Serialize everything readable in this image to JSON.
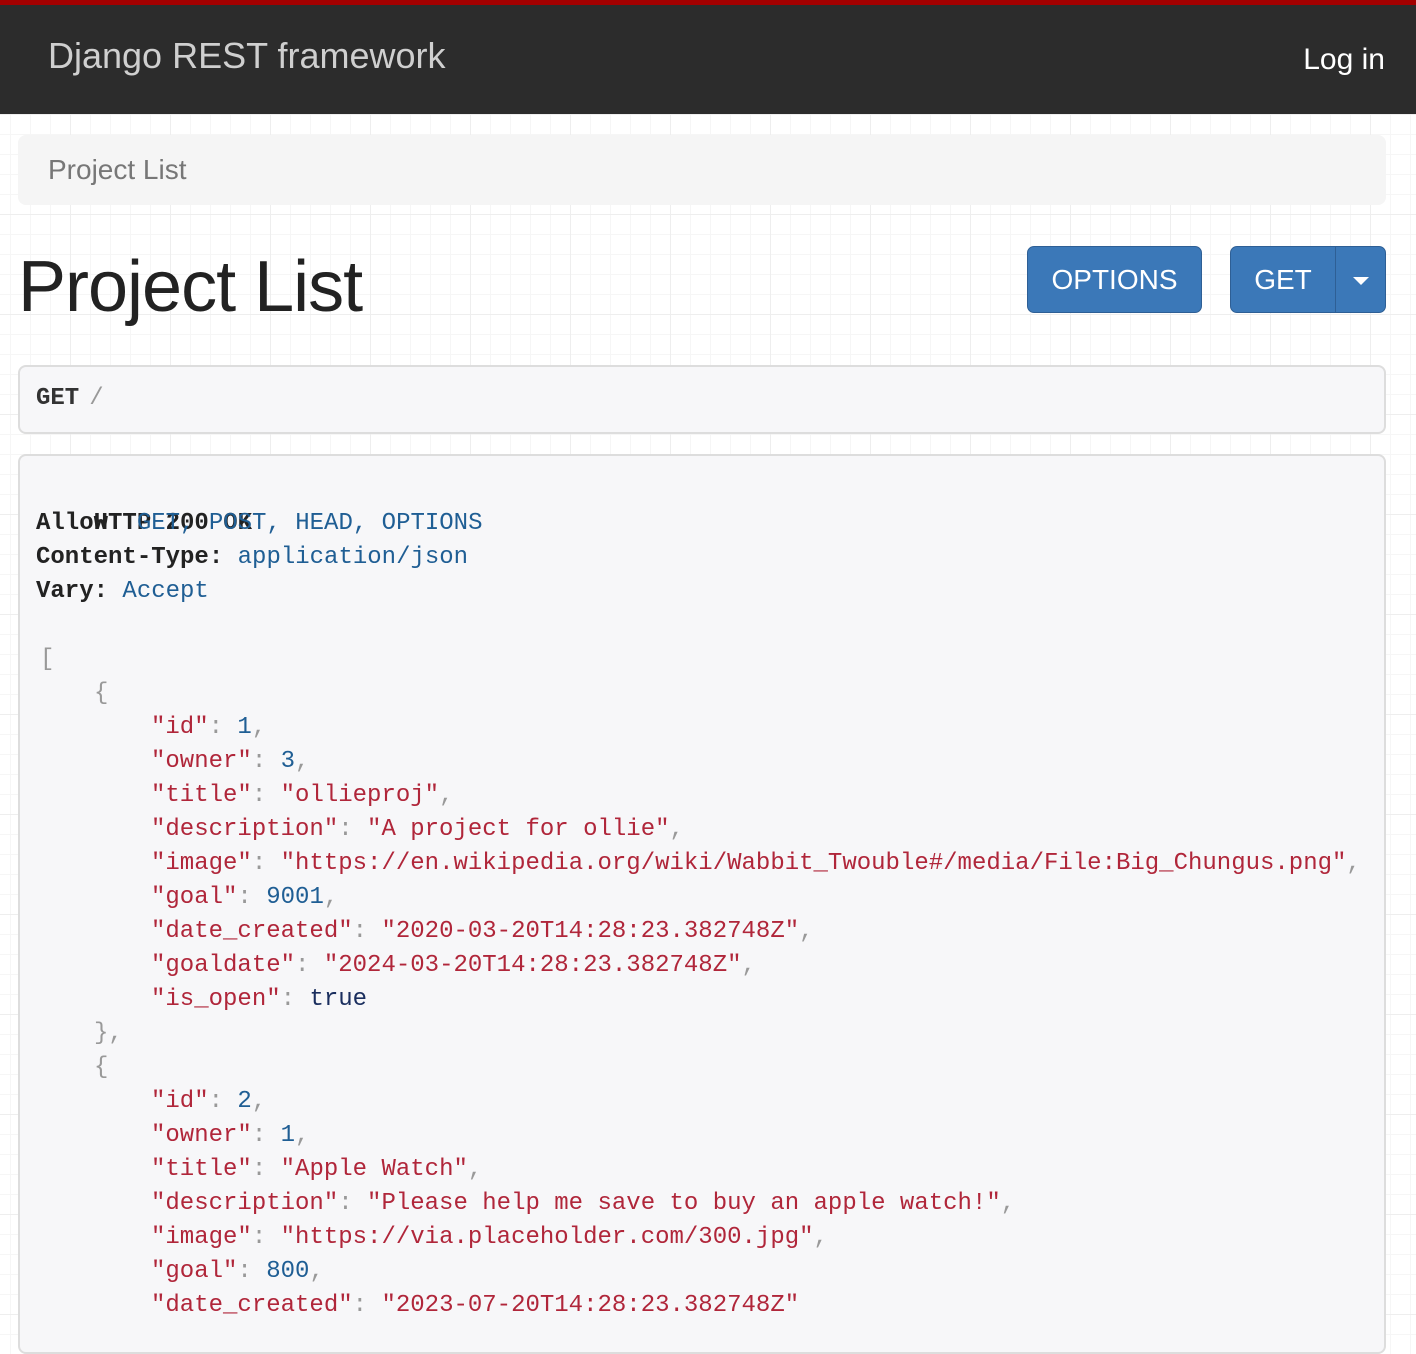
{
  "navbar": {
    "brand": "Django REST framework",
    "login": "Log in"
  },
  "breadcrumb": {
    "label": "Project List"
  },
  "page": {
    "title": "Project List"
  },
  "buttons": {
    "options": "OPTIONS",
    "get": "GET"
  },
  "request": {
    "method": "GET",
    "path": "/"
  },
  "response": {
    "status": "HTTP 200 OK",
    "headers": [
      {
        "key": "Allow:",
        "value": "GET, POST, HEAD, OPTIONS"
      },
      {
        "key": "Content-Type:",
        "value": "application/json"
      },
      {
        "key": "Vary:",
        "value": "Accept"
      }
    ],
    "items": [
      {
        "fields": [
          {
            "key": "\"id\"",
            "value": "1",
            "type": "num"
          },
          {
            "key": "\"owner\"",
            "value": "3",
            "type": "num"
          },
          {
            "key": "\"title\"",
            "value": "\"ollieproj\"",
            "type": "str"
          },
          {
            "key": "\"description\"",
            "value": "\"A project for ollie\"",
            "type": "str"
          },
          {
            "key": "\"image\"",
            "value": "\"https://en.wikipedia.org/wiki/Wabbit_Twouble#/media/File:Big_Chungus.png\"",
            "type": "str"
          },
          {
            "key": "\"goal\"",
            "value": "9001",
            "type": "num"
          },
          {
            "key": "\"date_created\"",
            "value": "\"2020-03-20T14:28:23.382748Z\"",
            "type": "str"
          },
          {
            "key": "\"goaldate\"",
            "value": "\"2024-03-20T14:28:23.382748Z\"",
            "type": "str"
          },
          {
            "key": "\"is_open\"",
            "value": "true",
            "type": "lit"
          }
        ]
      },
      {
        "fields": [
          {
            "key": "\"id\"",
            "value": "2",
            "type": "num"
          },
          {
            "key": "\"owner\"",
            "value": "1",
            "type": "num"
          },
          {
            "key": "\"title\"",
            "value": "\"Apple Watch\"",
            "type": "str"
          },
          {
            "key": "\"description\"",
            "value": "\"Please help me save to buy an apple watch!\"",
            "type": "str"
          },
          {
            "key": "\"image\"",
            "value": "\"https://via.placeholder.com/300.jpg\"",
            "type": "str"
          },
          {
            "key": "\"goal\"",
            "value": "800",
            "type": "num"
          },
          {
            "key": "\"date_created\"",
            "value": "\"2023-07-20T14:28:23.382748Z\"",
            "type": "str"
          }
        ]
      }
    ]
  }
}
